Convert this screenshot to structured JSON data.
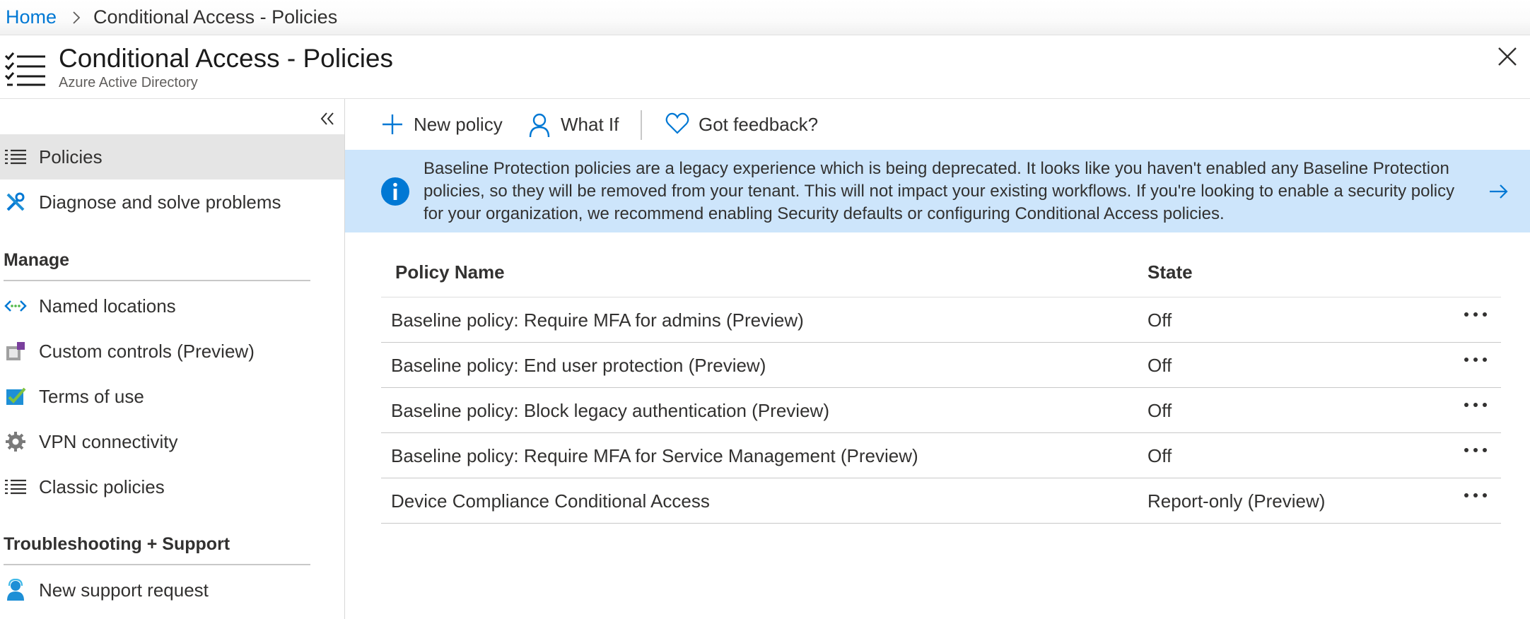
{
  "breadcrumb": {
    "home": "Home",
    "current": "Conditional Access - Policies"
  },
  "header": {
    "title": "Conditional Access - Policies",
    "subtitle": "Azure Active Directory"
  },
  "sidebar": {
    "items": [
      {
        "label": "Policies",
        "icon": "list-icon",
        "active": true
      },
      {
        "label": "Diagnose and solve problems",
        "icon": "wrench-icon"
      }
    ],
    "sections": [
      {
        "title": "Manage",
        "items": [
          {
            "label": "Named locations",
            "icon": "network-icon"
          },
          {
            "label": "Custom controls (Preview)",
            "icon": "custom-controls-icon"
          },
          {
            "label": "Terms of use",
            "icon": "checklist-icon"
          },
          {
            "label": "VPN connectivity",
            "icon": "gear-icon"
          },
          {
            "label": "Classic policies",
            "icon": "list-icon"
          }
        ]
      },
      {
        "title": "Troubleshooting + Support",
        "items": [
          {
            "label": "New support request",
            "icon": "support-person-icon"
          }
        ]
      }
    ]
  },
  "toolbar": {
    "new_policy": "New policy",
    "what_if": "What If",
    "feedback": "Got feedback?"
  },
  "banner": {
    "line1": "Baseline Protection policies are a legacy experience which is being deprecated. It looks like you haven't enabled any Baseline Protection",
    "line2": "policies, so they will be removed from your tenant. This will not impact your existing workflows. If you're looking to enable a security policy",
    "line3": "for your organization, we recommend enabling Security defaults or configuring Conditional Access policies."
  },
  "table": {
    "columns": [
      "Policy Name",
      "State"
    ],
    "rows": [
      {
        "name": "Baseline policy: Require MFA for admins (Preview)",
        "state": "Off"
      },
      {
        "name": "Baseline policy: End user protection (Preview)",
        "state": "Off"
      },
      {
        "name": "Baseline policy: Block legacy authentication (Preview)",
        "state": "Off"
      },
      {
        "name": "Baseline policy: Require MFA for Service Management (Preview)",
        "state": "Off"
      },
      {
        "name": "Device Compliance Conditional Access",
        "state": "Report-only (Preview)"
      }
    ]
  },
  "colors": {
    "link": "#0078d4",
    "banner_bg": "#cde5fb",
    "active_nav": "#e5e5e5",
    "icon_blue": "#0078d4"
  }
}
